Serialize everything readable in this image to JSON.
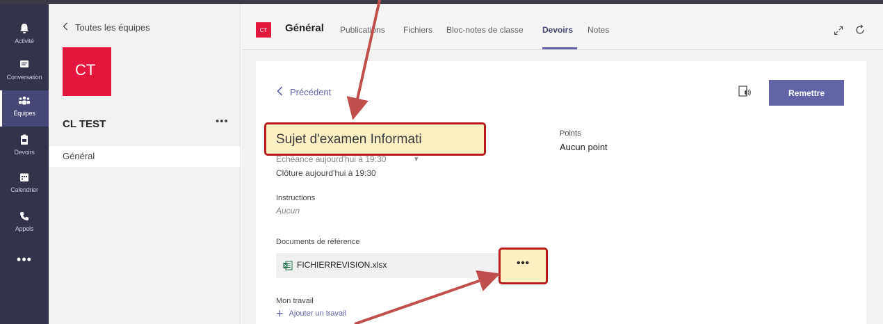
{
  "app_bar": {
    "items": [
      {
        "label": "Activité",
        "icon": "bell-icon"
      },
      {
        "label": "Conversation",
        "icon": "chat-icon"
      },
      {
        "label": "Équipes",
        "icon": "teams-icon",
        "active": true
      },
      {
        "label": "Devoirs",
        "icon": "assignments-icon"
      },
      {
        "label": "Calendrier",
        "icon": "calendar-icon"
      },
      {
        "label": "Appels",
        "icon": "phone-icon"
      }
    ],
    "more": "•••"
  },
  "team_panel": {
    "back_label": "Toutes les équipes",
    "avatar_initials": "CT",
    "team_name": "CL TEST",
    "team_menu": "•••",
    "channels": [
      "Général"
    ]
  },
  "channel_header": {
    "badge": "CT",
    "title": "Général",
    "tabs": [
      "Publications",
      "Fichiers",
      "Bloc-notes de classe",
      "Devoirs",
      "Notes"
    ],
    "active_tab": "Devoirs"
  },
  "assignment": {
    "back_label": "Précédent",
    "submit_label": "Remettre",
    "title": "Sujet d'examen Informati",
    "due": "Échéance aujourd'hui à 19:30",
    "close": "Clôture aujourd'hui à 19:30",
    "points_label": "Points",
    "points_value": "Aucun point",
    "instructions_label": "Instructions",
    "instructions_value": "Aucun",
    "reference_label": "Documents de référence",
    "file_name": "FICHIERREVISION.xlsx",
    "file_more": "•••",
    "work_label": "Mon travail",
    "add_work_label": "Ajouter un travail"
  },
  "colors": {
    "app_bar": "#33344a",
    "brand": "#6264a7",
    "team_red": "#e3173e",
    "highlight_border": "#b71c1c",
    "highlight_fill": "#fdf1c3",
    "arrow": "#c0504d"
  }
}
